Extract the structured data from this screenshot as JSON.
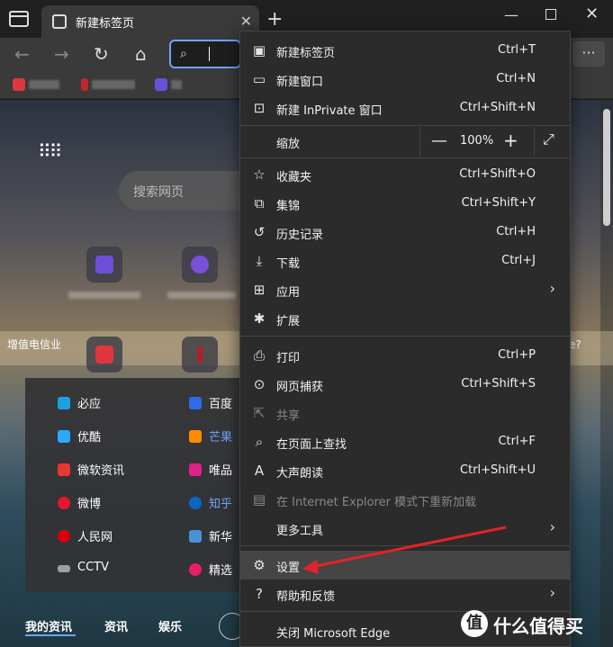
{
  "titlebar": {
    "tab_title": "新建标签页",
    "tab_close": "✕",
    "new_tab": "+",
    "minimize": "—",
    "close": "✕"
  },
  "navbar": {
    "back": "←",
    "forward": "→",
    "refresh": "↻",
    "home": "⌂",
    "search_icon": "⌕",
    "more": "···"
  },
  "page": {
    "search_placeholder": "搜索网页",
    "apps_icon": "⠿⠿",
    "strip_text": "增值电信业",
    "strip_right": "e?",
    "links": [
      {
        "label": "必应",
        "color": "#1ba1e2"
      },
      {
        "label": "百度",
        "color": "#2e6be6"
      },
      {
        "label": "优酷",
        "color": "#2aa9ff"
      },
      {
        "label": "芒果",
        "color": "#ff8a00"
      },
      {
        "label": "微软资讯",
        "color": "#e8372e"
      },
      {
        "label": "唯品",
        "color": "#e0218a"
      },
      {
        "label": "微博",
        "color": "#e6162d"
      },
      {
        "label": "知乎",
        "color": "#0a66c2"
      },
      {
        "label": "人民网",
        "color": "#d7000f"
      },
      {
        "label": "新华",
        "color": "#4a90d9"
      },
      {
        "label": "CCTV",
        "color": "#9aa0a6"
      },
      {
        "label": "精选",
        "color": "#e91e63"
      }
    ],
    "bottom_tabs": [
      "我的资讯",
      "资讯",
      "娱乐"
    ]
  },
  "menu": {
    "items": [
      {
        "icon": "▣",
        "label": "新建标签页",
        "shortcut": "Ctrl+T"
      },
      {
        "icon": "▭",
        "label": "新建窗口",
        "shortcut": "Ctrl+N"
      },
      {
        "icon": "⊡",
        "label": "新建 InPrivate 窗口",
        "shortcut": "Ctrl+Shift+N"
      },
      {
        "icon": "",
        "label": "缩放",
        "shortcut": ""
      },
      {
        "icon": "☆",
        "label": "收藏夹",
        "shortcut": "Ctrl+Shift+O"
      },
      {
        "icon": "⧉",
        "label": "集锦",
        "shortcut": "Ctrl+Shift+Y"
      },
      {
        "icon": "↺",
        "label": "历史记录",
        "shortcut": "Ctrl+H"
      },
      {
        "icon": "⤓",
        "label": "下载",
        "shortcut": "Ctrl+J"
      },
      {
        "icon": "⊞",
        "label": "应用",
        "shortcut": ""
      },
      {
        "icon": "✱",
        "label": "扩展",
        "shortcut": ""
      },
      {
        "icon": "⎙",
        "label": "打印",
        "shortcut": "Ctrl+P"
      },
      {
        "icon": "⊙",
        "label": "网页捕获",
        "shortcut": "Ctrl+Shift+S"
      },
      {
        "icon": "⇱",
        "label": "共享",
        "shortcut": ""
      },
      {
        "icon": "⌕",
        "label": "在页面上查找",
        "shortcut": "Ctrl+F"
      },
      {
        "icon": "A",
        "label": "大声朗读",
        "shortcut": "Ctrl+Shift+U"
      },
      {
        "icon": "▤",
        "label": "在 Internet Explorer 模式下重新加载",
        "shortcut": ""
      },
      {
        "icon": "",
        "label": "更多工具",
        "shortcut": ""
      },
      {
        "icon": "⚙",
        "label": "设置",
        "shortcut": ""
      },
      {
        "icon": "?",
        "label": "帮助和反馈",
        "shortcut": ""
      },
      {
        "icon": "",
        "label": "关闭 Microsoft Edge",
        "shortcut": ""
      }
    ],
    "zoom": {
      "minus": "—",
      "value": "100%",
      "plus": "+",
      "fullscreen": "⤢"
    },
    "submenu_arrow": "›"
  },
  "watermark": {
    "logo": "值",
    "text": "什么值得买"
  },
  "colors": {
    "annotation_arrow": "#e0242a",
    "accent": "#6ea3ff"
  }
}
